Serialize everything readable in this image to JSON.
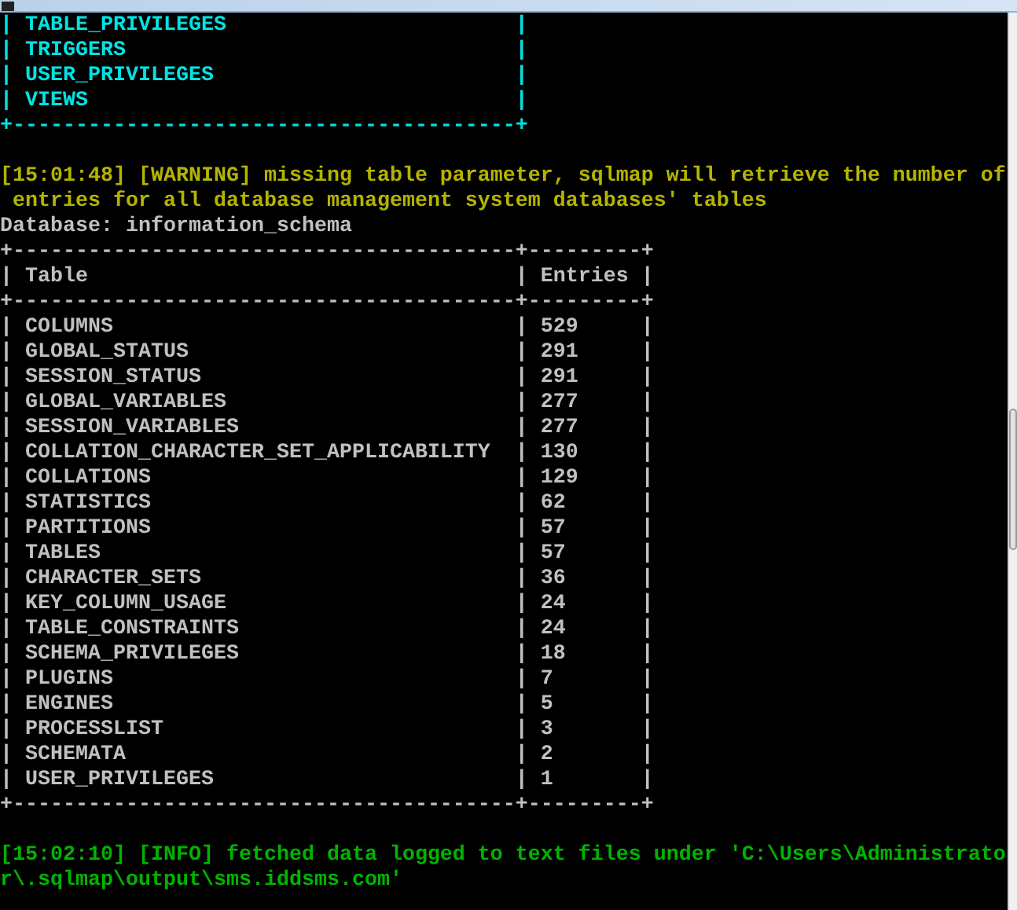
{
  "console": {
    "lines": [
      {
        "kind": "table",
        "text": "| TABLE_PRIVILEGES                       |"
      },
      {
        "kind": "table",
        "text": "| TRIGGERS                               |"
      },
      {
        "kind": "table",
        "text": "| USER_PRIVILEGES                        |"
      },
      {
        "kind": "table",
        "text": "| VIEWS                                  |"
      },
      {
        "kind": "table",
        "text": "+----------------------------------------+"
      },
      {
        "kind": "gap"
      },
      {
        "kind": "warning",
        "text": "[15:01:48] [WARNING] missing table parameter, sqlmap will retrieve the number of"
      },
      {
        "kind": "warning",
        "text": " entries for all database management system databases' tables"
      },
      {
        "kind": "text",
        "text": "Database: information_schema"
      },
      {
        "kind": "text",
        "text": "+----------------------------------------+---------+"
      },
      {
        "kind": "text",
        "text": "| Table                                  | Entries |"
      },
      {
        "kind": "text",
        "text": "+----------------------------------------+---------+"
      },
      {
        "kind": "text",
        "text": "| COLUMNS                                | 529     |"
      },
      {
        "kind": "text",
        "text": "| GLOBAL_STATUS                          | 291     |"
      },
      {
        "kind": "text",
        "text": "| SESSION_STATUS                         | 291     |"
      },
      {
        "kind": "text",
        "text": "| GLOBAL_VARIABLES                       | 277     |"
      },
      {
        "kind": "text",
        "text": "| SESSION_VARIABLES                      | 277     |"
      },
      {
        "kind": "text",
        "text": "| COLLATION_CHARACTER_SET_APPLICABILITY  | 130     |"
      },
      {
        "kind": "text",
        "text": "| COLLATIONS                             | 129     |"
      },
      {
        "kind": "text",
        "text": "| STATISTICS                             | 62      |"
      },
      {
        "kind": "text",
        "text": "| PARTITIONS                             | 57      |"
      },
      {
        "kind": "text",
        "text": "| TABLES                                 | 57      |"
      },
      {
        "kind": "text",
        "text": "| CHARACTER_SETS                         | 36      |"
      },
      {
        "kind": "text",
        "text": "| KEY_COLUMN_USAGE                       | 24      |"
      },
      {
        "kind": "text",
        "text": "| TABLE_CONSTRAINTS                      | 24      |"
      },
      {
        "kind": "text",
        "text": "| SCHEMA_PRIVILEGES                      | 18      |"
      },
      {
        "kind": "text",
        "text": "| PLUGINS                                | 7       |"
      },
      {
        "kind": "text",
        "text": "| ENGINES                                | 5       |"
      },
      {
        "kind": "text",
        "text": "| PROCESSLIST                            | 3       |"
      },
      {
        "kind": "text",
        "text": "| SCHEMATA                               | 2       |"
      },
      {
        "kind": "text",
        "text": "| USER_PRIVILEGES                        | 1       |"
      },
      {
        "kind": "text",
        "text": "+----------------------------------------+---------+"
      },
      {
        "kind": "gap"
      },
      {
        "kind": "info",
        "text": "[15:02:10] [INFO] fetched data logged to text files under 'C:\\Users\\Administrato"
      },
      {
        "kind": "info",
        "text": "r\\.sqlmap\\output\\sms.iddsms.com'"
      }
    ]
  }
}
